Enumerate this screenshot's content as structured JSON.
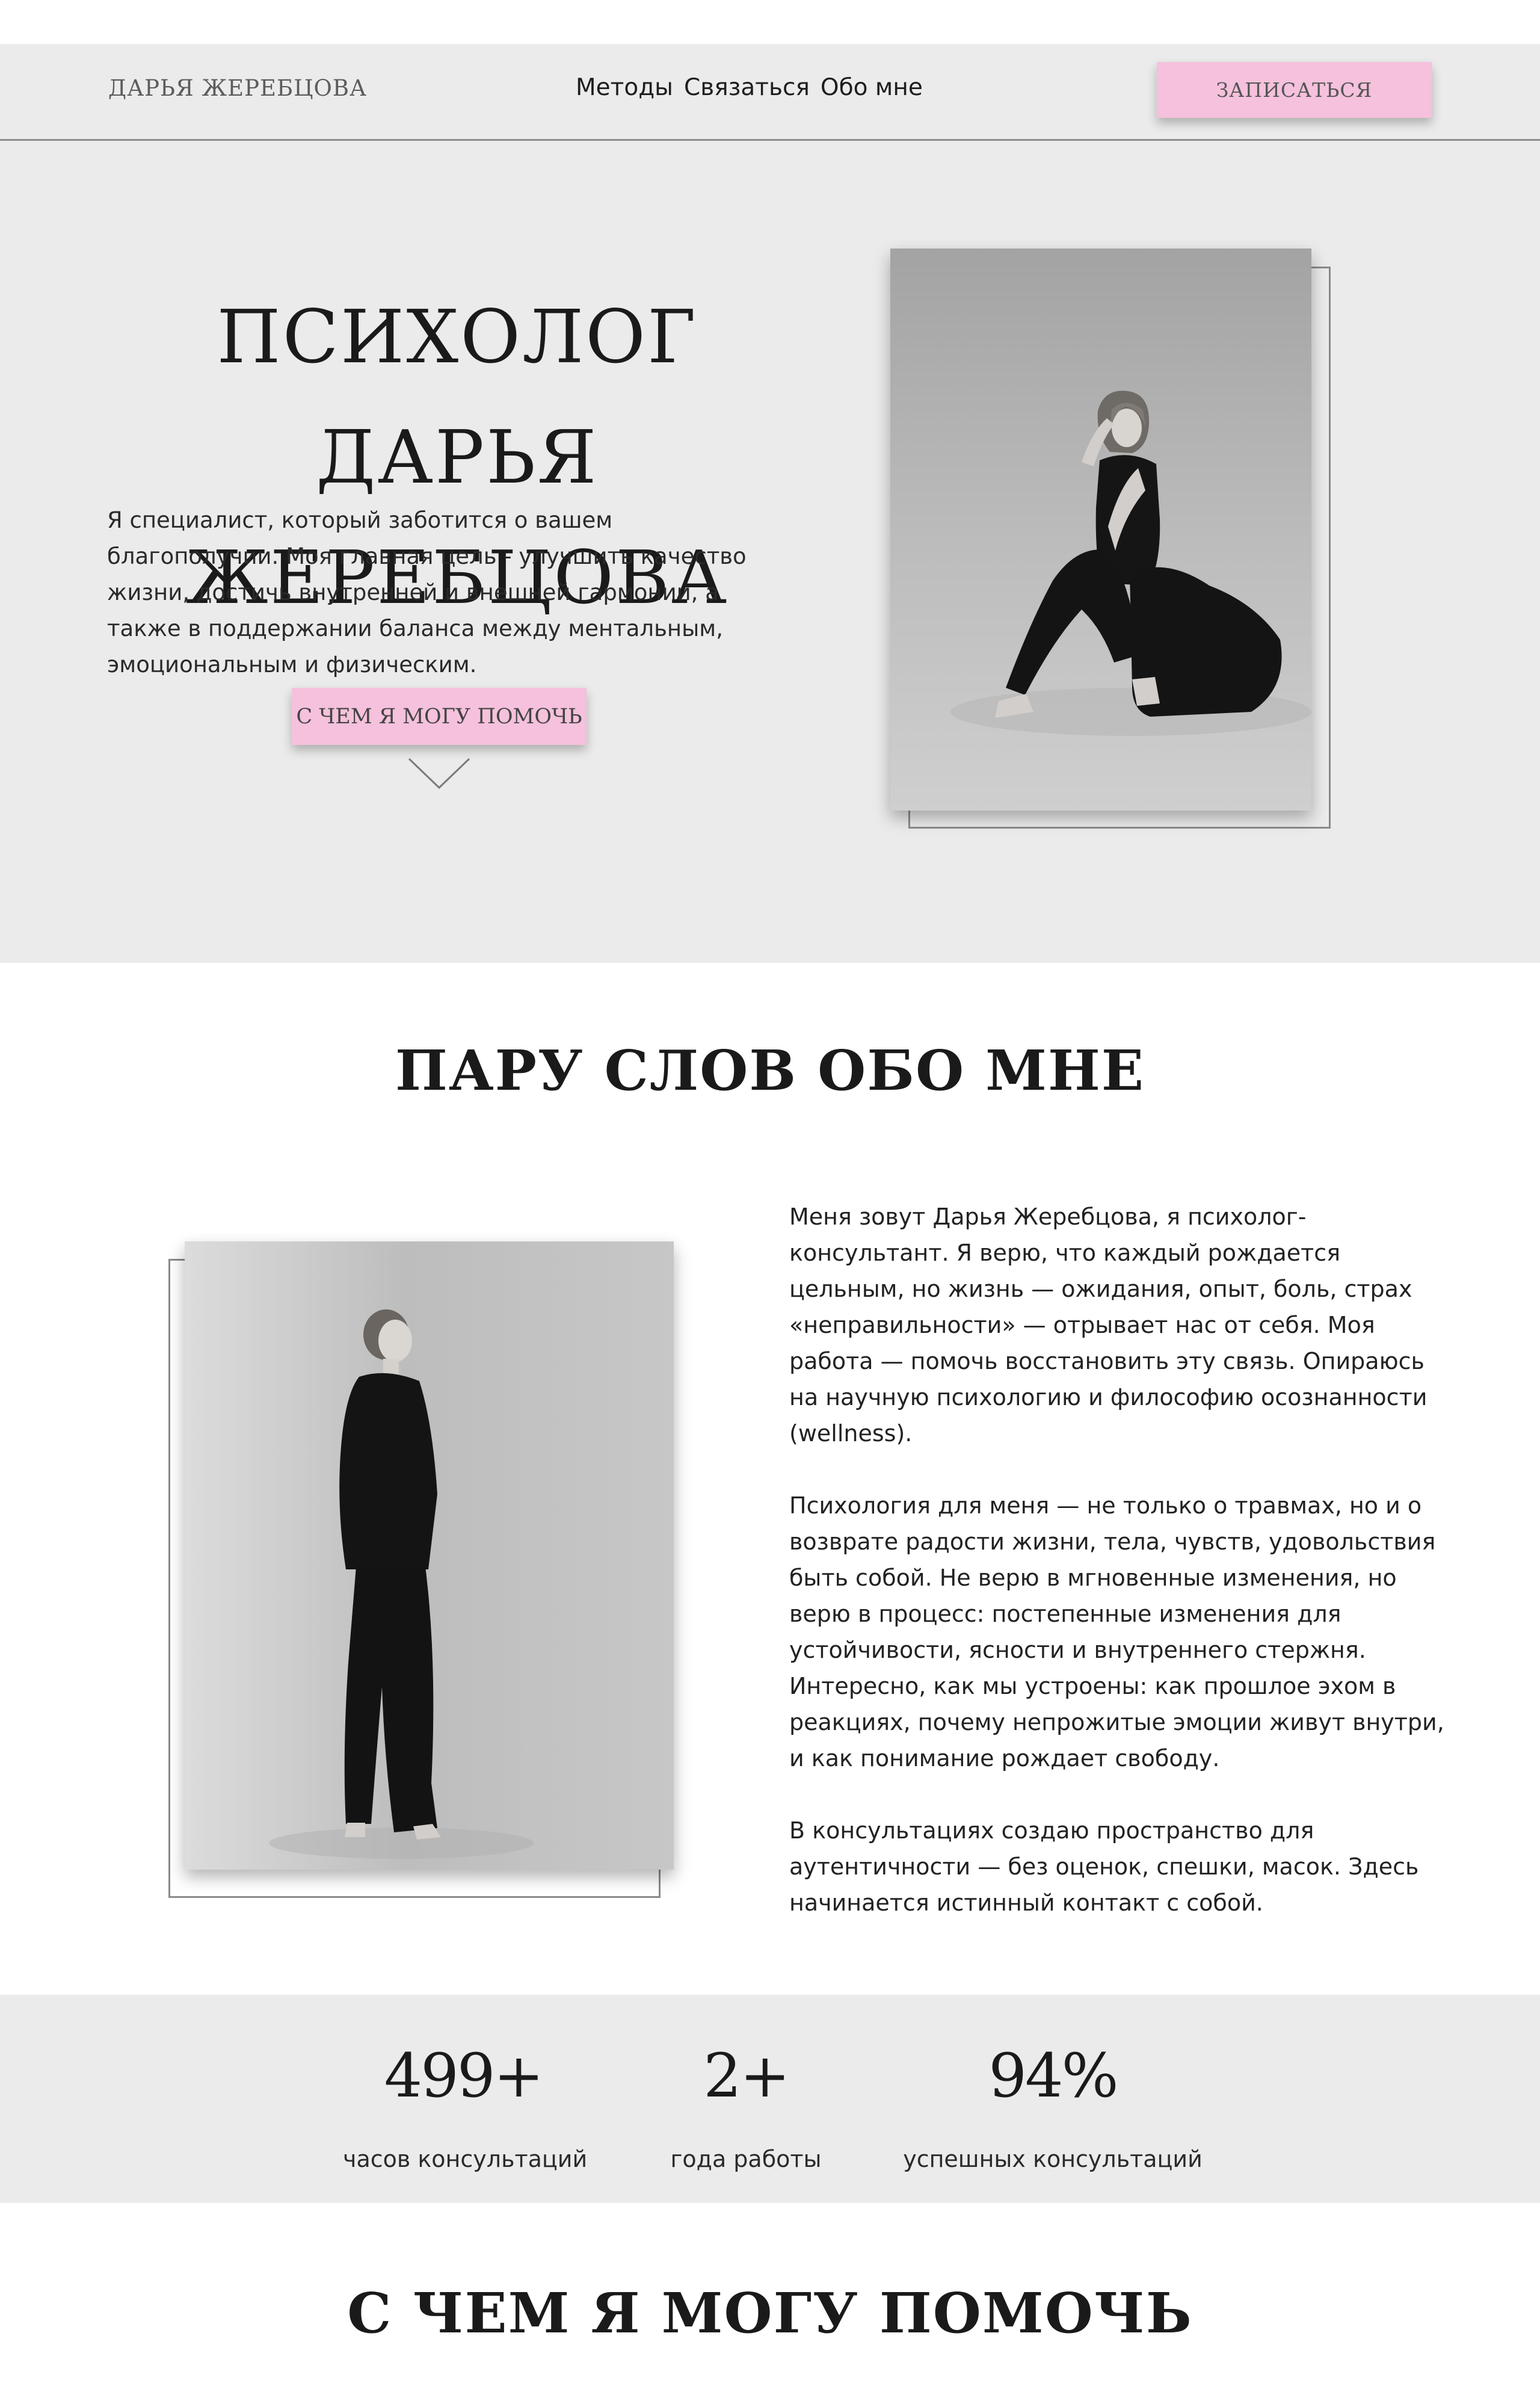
{
  "header": {
    "logo": "ДАРЬЯ ЖЕРЕБЦОВА",
    "nav": [
      "Методы",
      "Связаться",
      "Обо мне"
    ],
    "cta_label": "ЗАПИСАТЬСЯ"
  },
  "hero": {
    "title_line1": "ПСИХОЛОГ ДАРЬЯ",
    "title_line2": "ЖЕРЕБЦОВА",
    "text": "Я специалист, который заботится о вашем благополучии. Моя главная цель - улучшить качество жизни, достичь внутренней и внешней гармонии, а также в поддержании баланса между ментальным, эмоциональным и физическим.",
    "cta_label": "С ЧЕМ Я МОГУ ПОМОЧЬ"
  },
  "about": {
    "title": "ПАРУ СЛОВ ОБО МНЕ",
    "paragraphs": [
      "Меня зовут Дарья Жеребцова, я психолог-консультант. Я верю, что каждый рождается цельным, но жизнь — ожидания, опыт, боль, страх «неправильности» — отрывает нас от себя. Моя работа — помочь восстановить эту связь. Опираюсь на научную психологию и философию осознанности (wellness).",
      "Психология для меня — не только о травмах, но и о возврате радости жизни, тела, чувств, удовольствия быть собой. Не верю в мгновенные изменения, но верю в процесс: постепенные изменения для устойчивости, ясности и внутреннего стержня. Интересно, как мы устроены: как прошлое эхом в реакциях, почему непрожитые эмоции живут внутри, и как понимание рождает свободу.",
      "В консультациях создаю пространство для аутентичности — без оценок, спешки, масок. Здесь начинается истинный контакт с собой."
    ]
  },
  "stats": [
    {
      "value": "499+",
      "label": "часов консультаций"
    },
    {
      "value": "2+",
      "label": "года работы"
    },
    {
      "value": "94%",
      "label": "успешных консультаций"
    }
  ],
  "help": {
    "title": "С ЧЕМ Я МОГУ ПОМОЧЬ"
  },
  "colors": {
    "accent_pink": "#f5c1dc",
    "section_gray": "#ebebeb"
  }
}
